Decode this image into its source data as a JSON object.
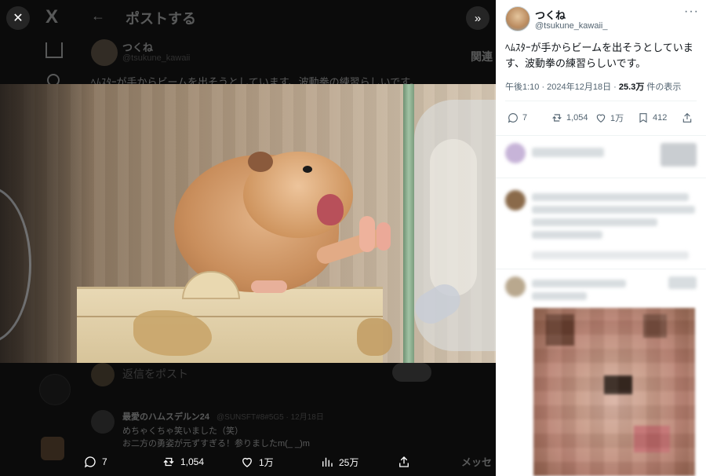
{
  "background": {
    "logo": "X",
    "header_title": "ポストする",
    "author_name": "つくね",
    "author_handle": "@tsukune_kawaii",
    "post_text": "ﾍﾑｽﾀｰが手からビームを出そうとしています、波動拳の練習らしいです。",
    "related_heading": "関連",
    "reply_prompt": "返信をポスト",
    "comment": {
      "name": "最愛のハムスデルン24",
      "meta": "@SUNSFT#8#5G5 · 12月18日",
      "line1": "めちゃくちゃ笑いました（笑）",
      "line2": "お二方の勇姿が元ずすぎる！参りましたm(_ _)m"
    },
    "more": "メッセ"
  },
  "overlay": {
    "close_icon": "close-icon",
    "expand_icon": "chevrons-right-icon"
  },
  "media_actions": {
    "replies": "7",
    "reposts": "1,054",
    "likes": "1万",
    "views": "25万"
  },
  "post": {
    "author_name": "つくね",
    "author_handle": "@tsukune_kawaii_",
    "text": "ﾍﾑｽﾀｰが手からビームを出そうとしています、波動拳の練習らしいです。",
    "time": "午後1:10 · 2024年12月18日 · ",
    "views_count": "25.3万",
    "views_label": " 件の表示",
    "replies": "7",
    "reposts": "1,054",
    "likes": "1万",
    "bookmarks": "412"
  }
}
